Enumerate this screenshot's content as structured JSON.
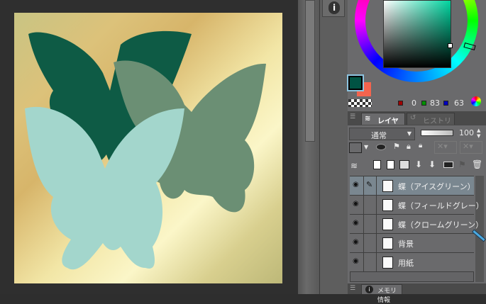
{
  "color": {
    "main_hex": "#005343",
    "sub_hex": "#f4644e",
    "r": "0",
    "g": "83",
    "b": "63",
    "red": "#a00000",
    "green": "#009000",
    "blue": "#0000c0"
  },
  "layer_panel": {
    "tabs": [
      {
        "label": "レイヤー"
      },
      {
        "label": "ヒストリー"
      }
    ],
    "blend_mode": "通常",
    "opacity": "100",
    "layers": [
      {
        "name": "蝶（アイスグリーン）",
        "selected": true,
        "editing": true
      },
      {
        "name": "蝶（フィールドグレー）",
        "selected": false
      },
      {
        "name": "蝶（クロームグリーン）",
        "selected": false
      },
      {
        "name": "背景",
        "selected": false
      },
      {
        "name": "用紙",
        "selected": false
      }
    ]
  },
  "bottom_panel": {
    "tab": "メモリ情報"
  },
  "butterflies": {
    "dark": "#0e5b45",
    "gray": "#6b8f74",
    "ice": "#a3d6cc"
  }
}
